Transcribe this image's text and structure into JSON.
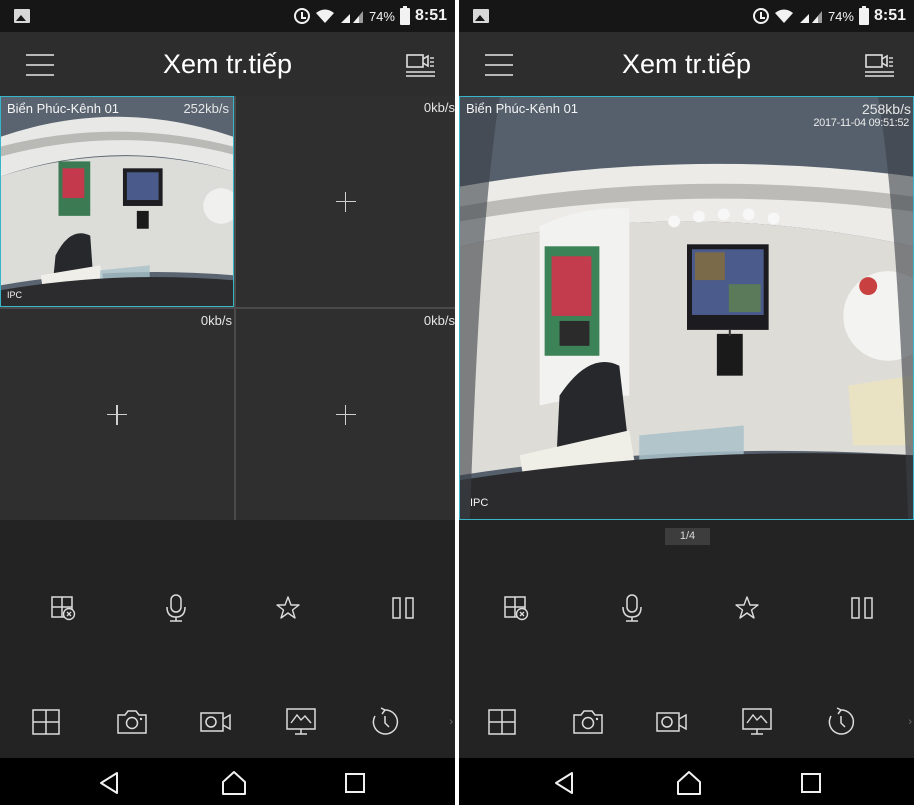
{
  "status_bar": {
    "battery": "74%",
    "time": "8:51"
  },
  "colors": {
    "selection_border": "#38b6c9",
    "background": "#232323",
    "titlebar": "#2d2d2d"
  },
  "left_phone": {
    "title": "Xem tr.tiếp",
    "cells": [
      {
        "channel": "Biển Phúc-Kênh 01",
        "bitrate": "252kb/s",
        "watermark": "IPC",
        "has_video": true
      },
      {
        "channel": "",
        "bitrate": "0kb/s",
        "has_video": false
      },
      {
        "channel": "",
        "bitrate": "0kb/s",
        "has_video": false
      },
      {
        "channel": "",
        "bitrate": "0kb/s",
        "has_video": false
      }
    ]
  },
  "right_phone": {
    "title": "Xem tr.tiếp",
    "cell": {
      "channel": "Biển Phúc-Kênh 01",
      "bitrate": "258kb/s",
      "timestamp": "2017-11-04 09:51:52",
      "watermark": "IPC"
    },
    "pager": "1/4"
  },
  "controls": [
    "close-window-icon",
    "microphone-icon",
    "favorite-star-icon",
    "pause-icon"
  ],
  "toolbar": [
    "split-screen-icon",
    "snapshot-camera-icon",
    "record-video-icon",
    "monitor-icon",
    "playback-history-icon"
  ],
  "nav": [
    "back-icon",
    "home-icon",
    "recents-icon"
  ]
}
